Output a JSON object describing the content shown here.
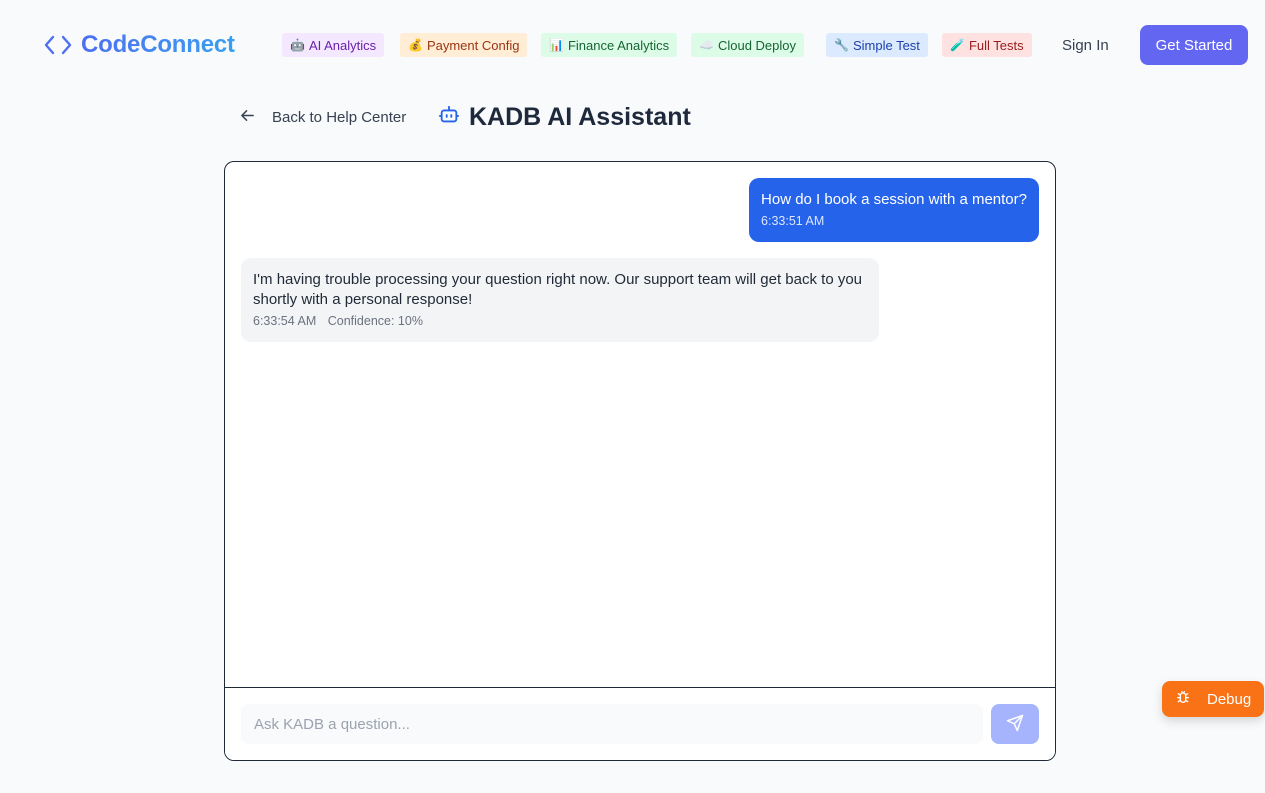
{
  "header": {
    "brand": "CodeConnect",
    "nav": [
      {
        "emoji": "🤖",
        "label": "AI Analytics",
        "bg": "#f3e8ff",
        "color": "#6b21a8"
      },
      {
        "emoji": "💰",
        "label": "Payment Config",
        "bg": "#ffedd5",
        "color": "#9a3412"
      },
      {
        "emoji": "📊",
        "label": "Finance Analytics",
        "bg": "#dcfce7",
        "color": "#166534"
      },
      {
        "emoji": "☁️",
        "label": "Cloud Deploy",
        "bg": "#dcfce7",
        "color": "#166534"
      },
      {
        "emoji": "🔧",
        "label": "Simple Test",
        "bg": "#dbeafe",
        "color": "#1e40af"
      },
      {
        "emoji": "🧪",
        "label": "Full Tests",
        "bg": "#fee2e2",
        "color": "#991b1b"
      }
    ],
    "sign_in": "Sign In",
    "get_started": "Get Started"
  },
  "subheader": {
    "back_label": "Back to Help Center",
    "title": "KADB AI Assistant"
  },
  "chat": {
    "messages": [
      {
        "role": "user",
        "text": "How do I book a session with a mentor?",
        "time": "6:33:51 AM"
      },
      {
        "role": "assistant",
        "text": "I'm having trouble processing your question right now. Our support team will get back to you shortly with a personal response!",
        "time": "6:33:54 AM",
        "confidence": "Confidence: 10%"
      }
    ],
    "input_placeholder": "Ask KADB a question...",
    "input_value": ""
  },
  "debug": {
    "label": "Debug"
  },
  "colors": {
    "accent": "#6366f1",
    "user_bubble": "#2563eb",
    "send_button": "#a5b4fc",
    "debug": "#f97316"
  }
}
